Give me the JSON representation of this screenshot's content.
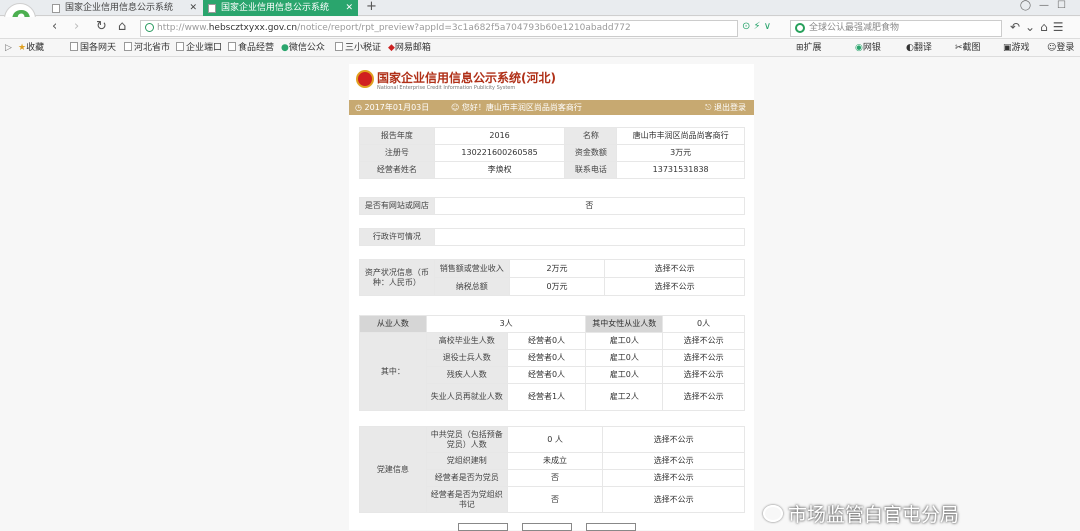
{
  "browser": {
    "tabs": [
      {
        "title": "国家企业信用信息公示系统"
      },
      {
        "title": "国家企业信用信息公示系统"
      }
    ],
    "url_prefix": "http://www.",
    "url_host": "hebscztxyxx.gov.cn",
    "url_path": "/notice/report/rpt_preview?appId=3c1a682f5a704793b60e1210abadd772",
    "search_placeholder": "全球公认最强减肥食物",
    "favorites": [
      "收藏",
      "国各网天",
      "河北省市",
      "企业端口",
      "食品经营",
      "微信公众",
      "三小税证",
      "网易邮箱"
    ],
    "right_tools": [
      "扩展",
      "网银",
      "翻译",
      "截图",
      "游戏",
      "登录"
    ]
  },
  "header": {
    "system_name": "国家企业信用信息公示系统(河北)",
    "system_name_en": "National Enterprise Credit Information Publicity System",
    "date": "2017年01月03日",
    "welcome": "您好！唐山市丰润区尚品尚客商行",
    "exit": "退出登录"
  },
  "basic": [
    [
      {
        "k": "报告年度",
        "v": "2016"
      },
      {
        "k": "名称",
        "v": "唐山市丰润区尚品尚客商行"
      }
    ],
    [
      {
        "k": "注册号",
        "v": "130221600260585"
      },
      {
        "k": "资金数额",
        "v": "3万元"
      }
    ],
    [
      {
        "k": "经营者姓名",
        "v": "李焕权"
      },
      {
        "k": "联系电话",
        "v": "13731531838"
      }
    ]
  ],
  "website": {
    "label": "是否有网站或网店",
    "value": "否"
  },
  "license": {
    "label": "行政许可情况"
  },
  "assets": {
    "label": "资产状况信息（币种：人民币）",
    "rows": [
      {
        "k": "销售额或营业收入",
        "v": "2万元",
        "s": "选择不公示"
      },
      {
        "k": "纳税总额",
        "v": "0万元",
        "s": "选择不公示"
      }
    ]
  },
  "staff": {
    "label": "从业人数",
    "value": "3人",
    "female_label": "其中女性从业人数",
    "female_value": "0人",
    "among": "其中：",
    "rows": [
      {
        "k": "高校毕业生人数",
        "a": "经营者0人",
        "b": "雇工0人",
        "s": "选择不公示"
      },
      {
        "k": "退役士兵人数",
        "a": "经营者0人",
        "b": "雇工0人",
        "s": "选择不公示"
      },
      {
        "k": "残疾人人数",
        "a": "经营者0人",
        "b": "雇工0人",
        "s": "选择不公示"
      },
      {
        "k": "失业人员再就业人数",
        "a": "经营者1人",
        "b": "雇工2人",
        "s": "选择不公示"
      }
    ]
  },
  "party": {
    "label": "党建信息",
    "rows": [
      {
        "k": "中共党员（包括预备党员）人数",
        "v": "0 人",
        "s": "选择不公示"
      },
      {
        "k": "党组织建制",
        "v": "未成立",
        "s": "选择不公示"
      },
      {
        "k": "经营者是否为党员",
        "v": "否",
        "s": "选择不公示"
      },
      {
        "k": "经营者是否为党组织书记",
        "v": "否",
        "s": "选择不公示"
      }
    ]
  },
  "watermark": "市场监管白官屯分局"
}
